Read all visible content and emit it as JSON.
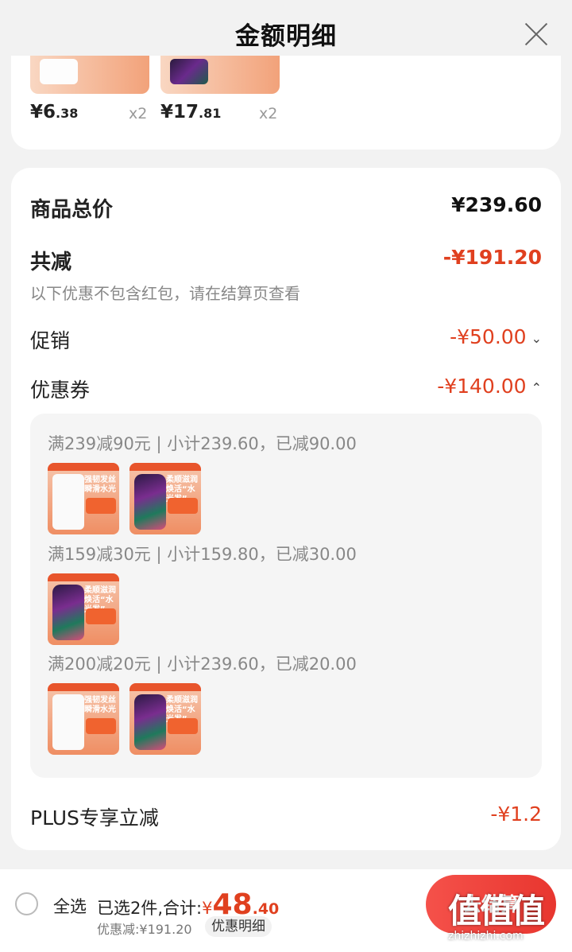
{
  "header": {
    "title": "金额明细"
  },
  "top_items": [
    {
      "price_main": "¥6",
      "price_dec": ".38",
      "qty": "x2"
    },
    {
      "price_main": "¥17",
      "price_dec": ".81",
      "qty": "x2"
    }
  ],
  "summary": {
    "total_label": "商品总价",
    "total_value": "¥239.60",
    "reduce_label": "共减",
    "reduce_value": "-¥191.20",
    "reduce_note": "以下优惠不包含红包，请在结算页查看",
    "promo_label": "促销",
    "promo_value": "-¥50.00",
    "coupon_label": "优惠券",
    "coupon_value": "-¥140.00",
    "plus_label": "PLUS专享立减",
    "plus_value": "-¥1.2"
  },
  "coupons": [
    {
      "title": "满239减90元 | 小计239.60，已减90.00"
    },
    {
      "title": "满159减30元 | 小计159.80，已减30.00"
    },
    {
      "title": "满200减20元 | 小计239.60，已减20.00"
    }
  ],
  "product_labels": {
    "pouch": "强韧发丝 瞬滑水光",
    "bottle": "柔顺滋润 焕活“水光发”"
  },
  "bottom": {
    "select_all": "全选",
    "selected_text": "已选2件,合计:",
    "yen": "¥",
    "total_big": "48",
    "total_small": ".40",
    "discount_text": "优惠减:¥191.20",
    "detail_chip": "优惠明细",
    "checkout": "去结算"
  },
  "watermark": {
    "logo": "值值值",
    "url": "zhizhizhi.com"
  },
  "colors": {
    "accent_red": "#e0401f",
    "button_red": "#e8362f"
  }
}
